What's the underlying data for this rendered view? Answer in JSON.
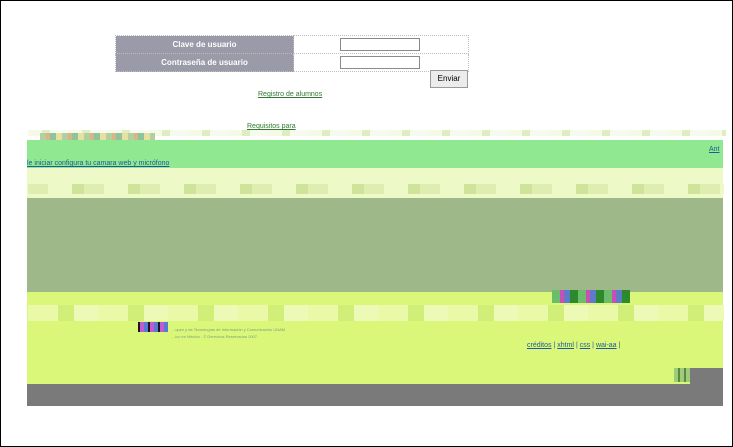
{
  "login": {
    "user_label": "Clave de usuario",
    "password_label": "Contraseña de usuario",
    "user_value": "",
    "password_value": "",
    "submit_label": "Enviar"
  },
  "links": {
    "registro": "Registro de alumnos",
    "requisitos": "Requisitos para"
  },
  "notice": {
    "camera": "le iniciar configura tu camara web y micrófono",
    "right_link": "Ant"
  },
  "footer": {
    "credits_line": "...quez y de Tecnologías de Información y Comunicación UNAM",
    "rights_line": "...ico en México - © Derechos Reservados 2007",
    "nav": [
      "créditos",
      "xhtml",
      "css",
      "wai-aa"
    ],
    "separator": "|"
  },
  "colors": {
    "green_band": "#90e890",
    "pale_band": "#eef9c8",
    "olive_band": "#9eb88a",
    "lime_band": "#dbf77a",
    "dark_band": "#7a7a7a",
    "label_bg": "#9a9aa8"
  }
}
